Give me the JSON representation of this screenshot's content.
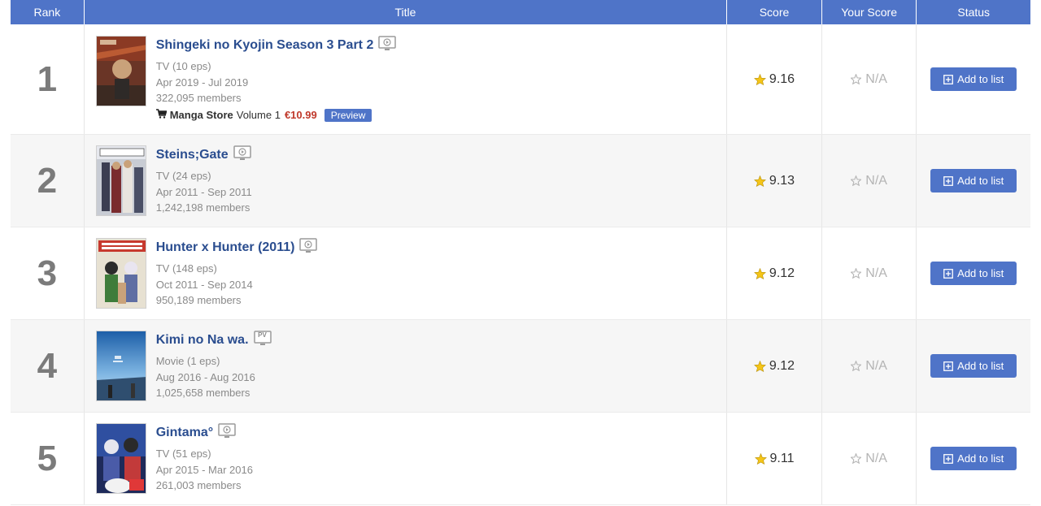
{
  "header": {
    "rank": "Rank",
    "title": "Title",
    "score": "Score",
    "your_score": "Your Score",
    "status": "Status"
  },
  "rows": [
    {
      "rank": "1",
      "title": "Shingeki no Kyojin Season 3 Part 2",
      "trailer_icon": "play-screen-icon",
      "type": "TV (10 eps)",
      "dates": "Apr 2019 - Jul 2019",
      "members": "322,095 members",
      "score": "9.16",
      "your_score": "N/A",
      "status_label": "Add to list",
      "store": {
        "label": "Manga Store",
        "volume": "Volume 1",
        "price": "€10.99",
        "preview": "Preview"
      }
    },
    {
      "rank": "2",
      "title": "Steins;Gate",
      "trailer_icon": "play-screen-icon",
      "type": "TV (24 eps)",
      "dates": "Apr 2011 - Sep 2011",
      "members": "1,242,198 members",
      "score": "9.13",
      "your_score": "N/A",
      "status_label": "Add to list"
    },
    {
      "rank": "3",
      "title": "Hunter x Hunter (2011)",
      "trailer_icon": "play-screen-icon",
      "type": "TV (148 eps)",
      "dates": "Oct 2011 - Sep 2014",
      "members": "950,189 members",
      "score": "9.12",
      "your_score": "N/A",
      "status_label": "Add to list"
    },
    {
      "rank": "4",
      "title": "Kimi no Na wa.",
      "trailer_icon": "pv-screen-icon",
      "trailer_badge": "PV",
      "type": "Movie (1 eps)",
      "dates": "Aug 2016 - Aug 2016",
      "members": "1,025,658 members",
      "score": "9.12",
      "your_score": "N/A",
      "status_label": "Add to list"
    },
    {
      "rank": "5",
      "title": "Gintama°",
      "trailer_icon": "play-screen-icon",
      "type": "TV (51 eps)",
      "dates": "Apr 2015 - Mar 2016",
      "members": "261,003 members",
      "score": "9.11",
      "your_score": "N/A",
      "status_label": "Add to list"
    }
  ],
  "colors": {
    "header_bg": "#4f74c8",
    "title_link": "#2a4d8f",
    "star": "#f5c518",
    "price": "#c0392b",
    "button": "#4f74c8"
  }
}
